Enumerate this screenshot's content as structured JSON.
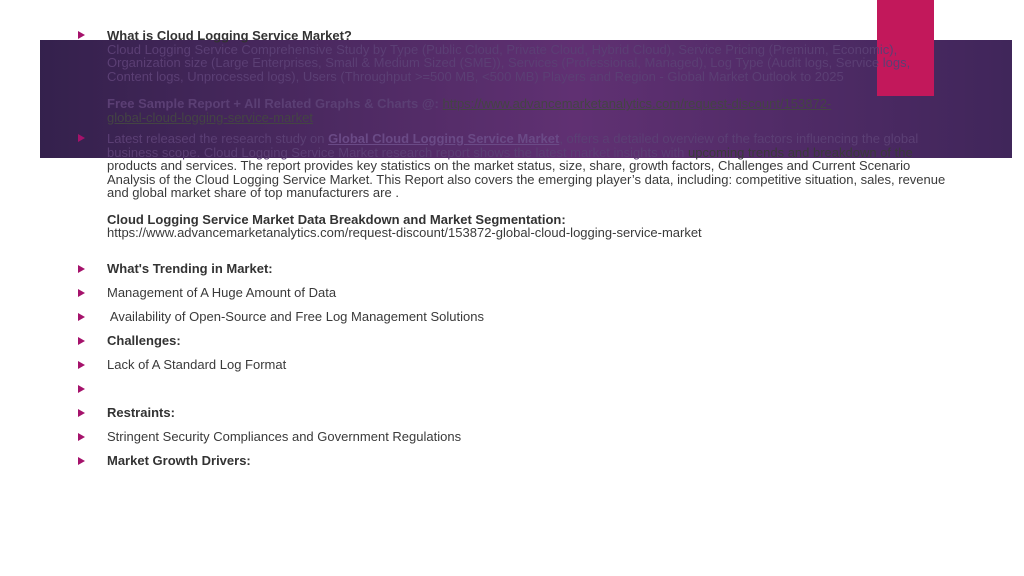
{
  "section1": {
    "heading": "What is Cloud Logging Service Market?",
    "desc": "Cloud Logging Service Comprehensive Study by Type (Public Cloud, Private Cloud, Hybrid Cloud), Service Pricing (Premium, Economic), Organization size (Large Enterprises, Small & Medium Sized (SME)), Services (Professional, Managed), Log Type (Audit logs, Service logs, Content logs, Unprocessed logs), Users (Throughput >=500 MB, <500 MB) Players and Region - Global Market Outlook to 2025",
    "sample_label": "Free Sample Report + All Related Graphs & Charts @:",
    "sample_url_line1": "https://www.advancemarketanalytics.com/request-discount/153872-",
    "sample_url_line2": "global-cloud-logging-service-market"
  },
  "section2": {
    "intro": "Latest released the research study on",
    "link_text": "Global Cloud Logging Service Market",
    "text_line1_rest": ", offers a detailed overview of the factors influencing the global business scope. Cloud Logging Service Market research report shows the latest market insights with",
    "text_rest": "upcoming trends and breakdown of the products and services. The report provides key statistics on the market status, size, share, growth factors, Challenges and Current Scenario Analysis of the Cloud Logging Service Market. This Report also covers the emerging player’s data, including: competitive situation, sales, revenue and global market share of top manufacturers are .",
    "breakdown_heading": "Cloud Logging Service Market Data Breakdown and Market Segmentation:",
    "breakdown_url": "https://www.advancemarketanalytics.com/request-discount/153872-global-cloud-logging-service-market"
  },
  "list": [
    {
      "text": "What's Trending in Market:",
      "bold": true
    },
    {
      "text": "Management of A Huge Amount of Data",
      "bold": false
    },
    {
      "text": " Availability of Open-Source and Free Log Management Solutions",
      "bold": false
    },
    {
      "text": "Challenges:",
      "bold": true
    },
    {
      "text": "Lack of A Standard Log Format",
      "bold": false
    },
    {
      "text": "",
      "bold": false
    },
    {
      "text": "Restraints:",
      "bold": true
    },
    {
      "text": "Stringent Security Compliances and Government Regulations",
      "bold": false
    },
    {
      "text": "Market Growth Drivers:",
      "bold": true
    }
  ],
  "colors": {
    "banner": "#3a1f55",
    "accent_pink": "#c2185b",
    "bullet": "#a5126b"
  }
}
